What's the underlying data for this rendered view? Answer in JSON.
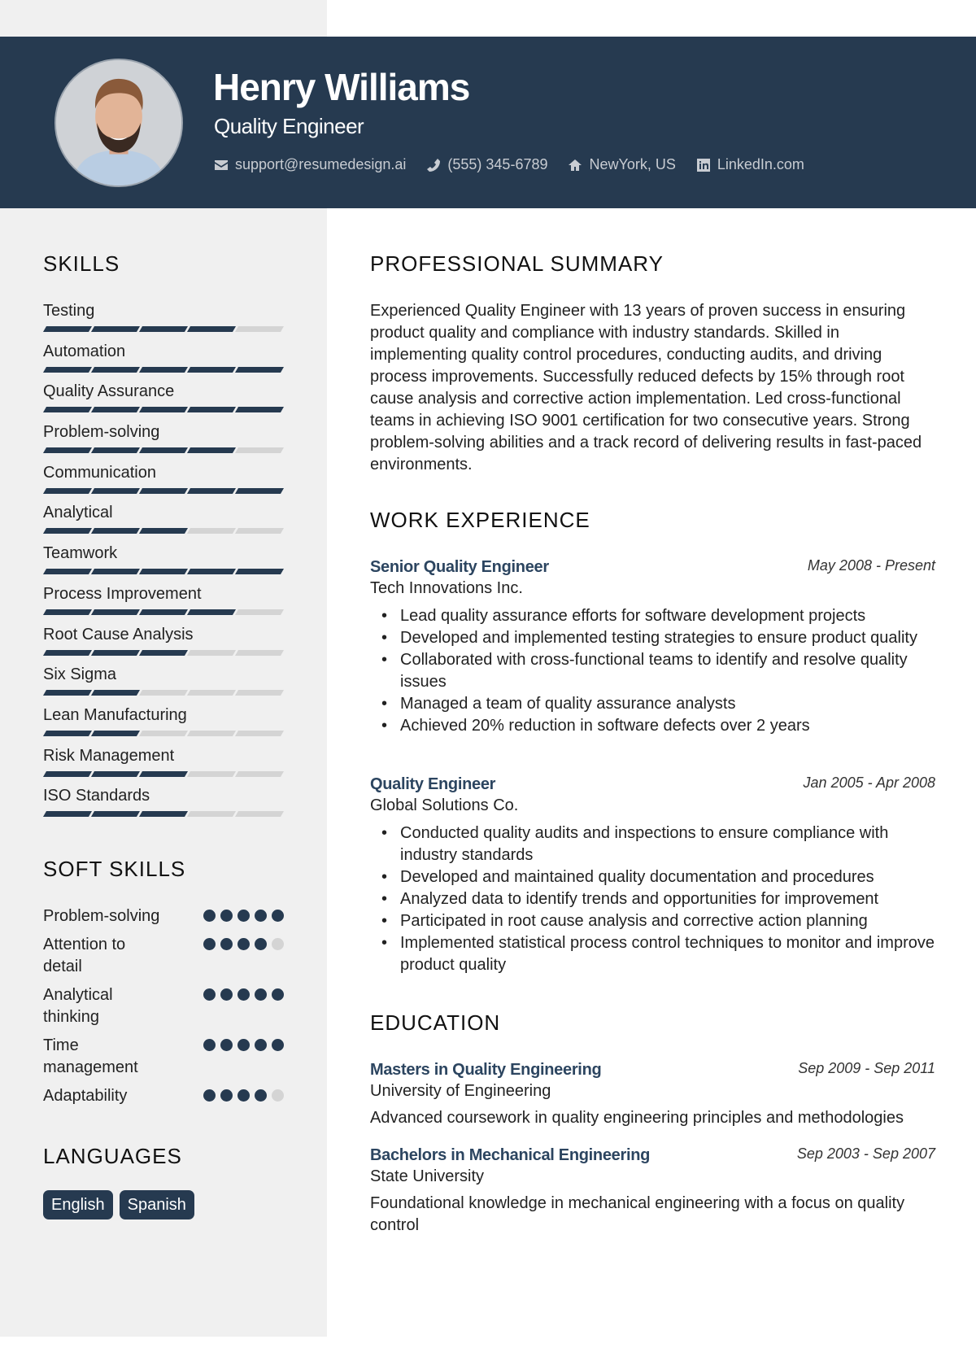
{
  "header": {
    "name": "Henry Williams",
    "title": "Quality Engineer",
    "contacts": [
      {
        "icon": "envelope-icon",
        "text": "support@resumedesign.ai"
      },
      {
        "icon": "phone-icon",
        "text": "(555) 345-6789"
      },
      {
        "icon": "home-icon",
        "text": "NewYork, US"
      },
      {
        "icon": "linkedin-icon",
        "text": "LinkedIn.com"
      }
    ]
  },
  "colors": {
    "accent": "#263a50",
    "sidebar_bg": "#f0f0f0",
    "inactive": "#d4d4d4",
    "job_title": "#2c4560"
  },
  "sidebar": {
    "skills_title": "SKILLS",
    "skills": [
      {
        "name": "Testing",
        "level": 4,
        "max": 5
      },
      {
        "name": "Automation",
        "level": 5,
        "max": 5
      },
      {
        "name": "Quality Assurance",
        "level": 5,
        "max": 5
      },
      {
        "name": "Problem-solving",
        "level": 4,
        "max": 5
      },
      {
        "name": "Communication",
        "level": 5,
        "max": 5
      },
      {
        "name": "Analytical",
        "level": 3,
        "max": 5
      },
      {
        "name": "Teamwork",
        "level": 5,
        "max": 5
      },
      {
        "name": "Process Improvement",
        "level": 4,
        "max": 5
      },
      {
        "name": "Root Cause Analysis",
        "level": 3,
        "max": 5
      },
      {
        "name": "Six Sigma",
        "level": 2,
        "max": 5
      },
      {
        "name": "Lean Manufacturing",
        "level": 2,
        "max": 5
      },
      {
        "name": "Risk Management",
        "level": 3,
        "max": 5
      },
      {
        "name": "ISO Standards",
        "level": 3,
        "max": 5
      }
    ],
    "soft_skills_title": "SOFT SKILLS",
    "soft_skills": [
      {
        "name": "Problem-solving",
        "level": 5,
        "max": 5
      },
      {
        "name": "Attention to detail",
        "level": 4,
        "max": 5
      },
      {
        "name": "Analytical thinking",
        "level": 5,
        "max": 5
      },
      {
        "name": "Time management",
        "level": 5,
        "max": 5
      },
      {
        "name": "Adaptability",
        "level": 4,
        "max": 5
      }
    ],
    "languages_title": "LANGUAGES",
    "languages": [
      "English",
      "Spanish"
    ]
  },
  "main": {
    "summary_title": "PROFESSIONAL SUMMARY",
    "summary": "Experienced Quality Engineer with 13 years of proven success in ensuring product quality and compliance with industry standards. Skilled in implementing quality control procedures, conducting audits, and driving process improvements. Successfully reduced defects by 15% through root cause analysis and corrective action implementation. Led cross-functional teams in achieving ISO 9001 certification for two consecutive years. Strong problem-solving abilities and a track record of delivering results in fast-paced environments.",
    "experience_title": "WORK EXPERIENCE",
    "jobs": [
      {
        "title": "Senior Quality Engineer",
        "date": "May 2008 - Present",
        "company": "Tech Innovations Inc.",
        "bullets": [
          "Lead quality assurance efforts for software development projects",
          "Developed and implemented testing strategies to ensure product quality",
          "Collaborated with cross-functional teams to identify and resolve quality issues",
          "Managed a team of quality assurance analysts",
          "Achieved 20% reduction in software defects over 2 years"
        ]
      },
      {
        "title": "Quality Engineer",
        "date": "Jan 2005 - Apr 2008",
        "company": "Global Solutions Co.",
        "bullets": [
          "Conducted quality audits and inspections to ensure compliance with industry standards",
          "Developed and maintained quality documentation and procedures",
          "Analyzed data to identify trends and opportunities for improvement",
          "Participated in root cause analysis and corrective action planning",
          "Implemented statistical process control techniques to monitor and improve product quality"
        ]
      }
    ],
    "education_title": "EDUCATION",
    "education": [
      {
        "degree": "Masters in Quality Engineering",
        "date": "Sep 2009 - Sep 2011",
        "school": "University of Engineering",
        "description": "Advanced coursework in quality engineering principles and methodologies"
      },
      {
        "degree": "Bachelors in Mechanical Engineering",
        "date": "Sep 2003 - Sep 2007",
        "school": "State University",
        "description": "Foundational knowledge in mechanical engineering with a focus on quality control"
      }
    ]
  }
}
